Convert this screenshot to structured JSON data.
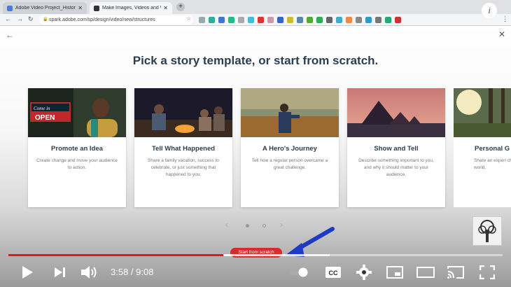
{
  "browser": {
    "tabs": [
      {
        "title": "Adobe Video Project_Historica",
        "active": false
      },
      {
        "title": "Make Images, Videos and Web",
        "active": true
      }
    ],
    "url": "spark.adobe.com/sp/design/video/new/structures"
  },
  "page": {
    "headline": "Pick a story template, or start from scratch.",
    "cards": [
      {
        "title": "Promote an Idea",
        "desc": "Create change and move your audience to action.",
        "image": "woman-at-open-sign"
      },
      {
        "title": "Tell What Happened",
        "desc": "Share a family vacation, success to celebrate, or just something that happened to you.",
        "image": "campfire-group"
      },
      {
        "title": "A Hero's Journey",
        "desc": "Tell how a regular person overcame a great challenge.",
        "image": "man-in-field"
      },
      {
        "title": "Show and Tell",
        "desc": "Describe something important to you, and why it should matter to your audience.",
        "image": "pyramids-sunset"
      },
      {
        "title": "Personal G",
        "desc": "Share an experi changed how yo world.",
        "image": "sunlit-forest"
      }
    ],
    "scratch_button": "Start from scratch"
  },
  "player": {
    "current_time": "3:58",
    "separator": " / ",
    "duration": "9:08",
    "played_fraction": 0.435,
    "buffered_fraction": 0.65,
    "accent_color": "#e01b1b"
  }
}
